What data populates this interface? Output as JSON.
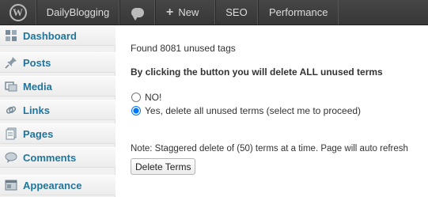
{
  "adminbar": {
    "site_name": "DailyBlogging",
    "new_label": "New",
    "seo_label": "SEO",
    "performance_label": "Performance"
  },
  "sidebar": {
    "items": [
      {
        "label": "Dashboard",
        "icon": "dashboard-icon"
      },
      {
        "label": "Posts",
        "icon": "posts-pin-icon"
      },
      {
        "label": "Media",
        "icon": "media-icon"
      },
      {
        "label": "Links",
        "icon": "links-icon"
      },
      {
        "label": "Pages",
        "icon": "pages-icon"
      },
      {
        "label": "Comments",
        "icon": "comments-icon"
      },
      {
        "label": "Appearance",
        "icon": "appearance-icon"
      }
    ]
  },
  "main": {
    "found_text": "Found 8081 unused tags",
    "warning_text": "By clicking the button you will delete ALL unused terms",
    "option_no": "NO!",
    "option_yes": "Yes, delete all unused terms (select me to proceed)",
    "selected_option": "yes",
    "note_text": "Note: Staggered delete of (50) terms at a time. Page will auto refresh",
    "button_label": "Delete Terms"
  },
  "colors": {
    "adminbar_bg": "#464646",
    "menu_link": "#21759b",
    "sidebar_bg": "#f1f1f1"
  }
}
